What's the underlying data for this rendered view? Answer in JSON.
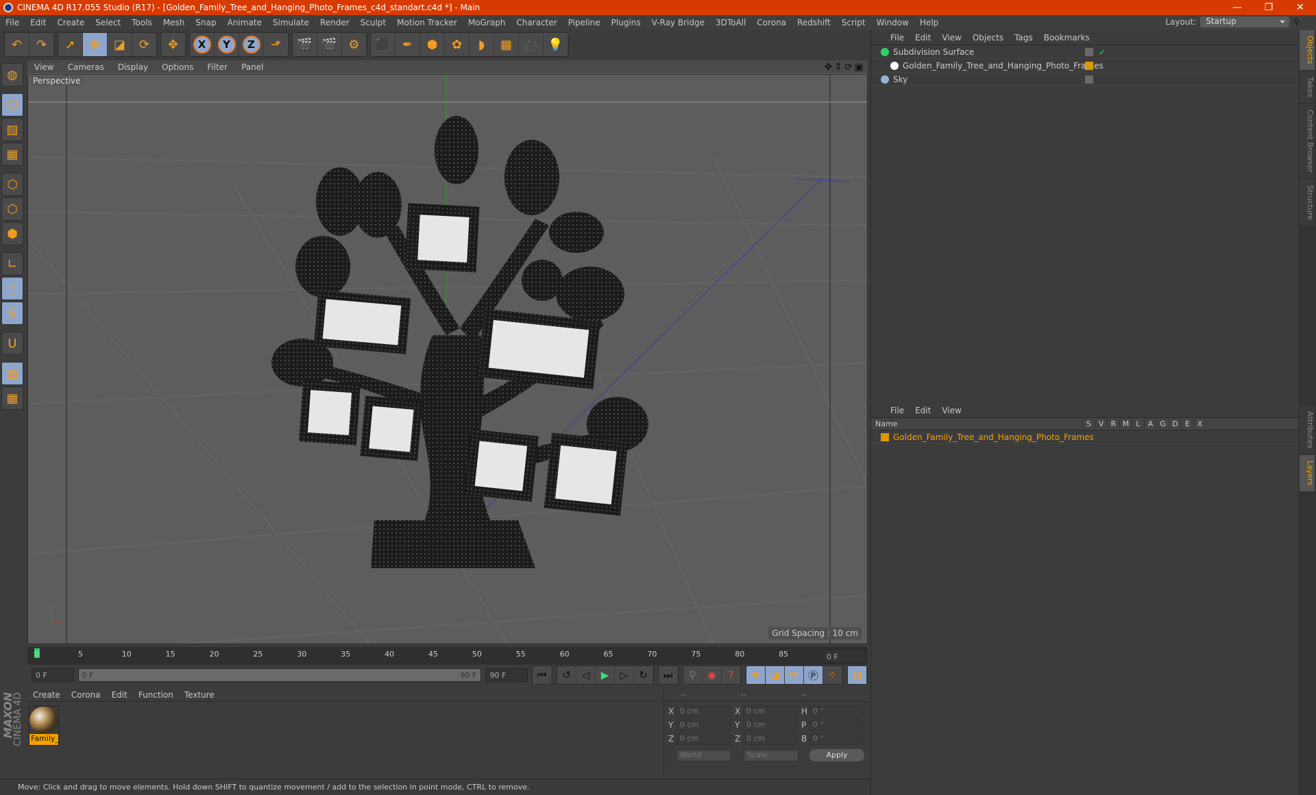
{
  "window": {
    "title": "CINEMA 4D R17.055 Studio (R17) - [Golden_Family_Tree_and_Hanging_Photo_Frames_c4d_standart.c4d *] - Main",
    "controls": [
      "minimize",
      "restore",
      "close"
    ]
  },
  "menubar": [
    "File",
    "Edit",
    "Create",
    "Select",
    "Tools",
    "Mesh",
    "Snap",
    "Animate",
    "Simulate",
    "Render",
    "Sculpt",
    "Motion Tracker",
    "MoGraph",
    "Character",
    "Pipeline",
    "Plugins",
    "V-Ray Bridge",
    "3DToAll",
    "Corona",
    "Redshift",
    "Script",
    "Window",
    "Help"
  ],
  "layout": {
    "label": "Layout:",
    "value": "Startup"
  },
  "toolbar": {
    "groups": [
      [
        {
          "name": "undo-icon",
          "glyph": "↶"
        },
        {
          "name": "redo-icon",
          "glyph": "↷"
        }
      ],
      [
        {
          "name": "select-icon",
          "glyph": "➚",
          "active": false
        },
        {
          "name": "move-icon",
          "glyph": "✥",
          "active": true
        },
        {
          "name": "scale-icon",
          "glyph": "◪"
        },
        {
          "name": "rotate-icon",
          "glyph": "⟳"
        }
      ],
      [
        {
          "name": "live-move-icon",
          "glyph": "✥"
        }
      ],
      [
        {
          "name": "x-axis-icon",
          "glyph": "X",
          "circle": true
        },
        {
          "name": "y-axis-icon",
          "glyph": "Y",
          "circle": true
        },
        {
          "name": "z-axis-icon",
          "glyph": "Z",
          "circle": true
        },
        {
          "name": "coordinate-system-icon",
          "glyph": "⬏"
        }
      ],
      [
        {
          "name": "render-view-icon",
          "glyph": "🎬"
        },
        {
          "name": "render-picture-viewer-icon",
          "glyph": "🎬"
        },
        {
          "name": "render-settings-icon",
          "glyph": "⚙"
        }
      ],
      [
        {
          "name": "cube-icon",
          "glyph": "⬛"
        },
        {
          "name": "pen-icon",
          "glyph": "✒"
        },
        {
          "name": "subdivision-icon",
          "glyph": "⬢"
        },
        {
          "name": "cloner-icon",
          "glyph": "✿"
        },
        {
          "name": "deformer-icon",
          "glyph": "◗"
        },
        {
          "name": "floor-icon",
          "glyph": "▦"
        },
        {
          "name": "camera-icon",
          "glyph": "🎥"
        },
        {
          "name": "light-icon",
          "glyph": "💡"
        }
      ]
    ]
  },
  "lefttools": [
    {
      "name": "model-mode-icon",
      "glyph": "◍",
      "active": false
    },
    {
      "sep": true
    },
    {
      "name": "object-mode-icon",
      "glyph": "⬡",
      "active": true
    },
    {
      "name": "texture-mode-icon",
      "glyph": "▨",
      "active": false
    },
    {
      "name": "workplane-icon",
      "glyph": "▦",
      "active": false
    },
    {
      "sep": true
    },
    {
      "name": "points-mode-icon",
      "glyph": "⬡",
      "active": false
    },
    {
      "name": "edges-mode-icon",
      "glyph": "⬡",
      "active": false
    },
    {
      "name": "polygons-mode-icon",
      "glyph": "⬢",
      "active": false
    },
    {
      "sep": true
    },
    {
      "name": "axis-mode-icon",
      "glyph": "∟",
      "active": false
    },
    {
      "name": "tweak-mode-icon",
      "glyph": "🖱",
      "active": true
    },
    {
      "name": "snap-icon",
      "glyph": "S",
      "active": true
    },
    {
      "sep": true
    },
    {
      "name": "magnet-icon",
      "glyph": "U",
      "active": false
    },
    {
      "sep": true
    },
    {
      "name": "lock-workplane-icon",
      "glyph": "▦",
      "active": true
    },
    {
      "name": "workplane-align-icon",
      "glyph": "▦",
      "active": false
    }
  ],
  "viewport": {
    "menu": [
      "View",
      "Cameras",
      "Display",
      "Options",
      "Filter",
      "Panel"
    ],
    "camera_label": "Perspective",
    "grid_spacing": "Grid Spacing : 10 cm",
    "nav_icons": [
      "move-view-icon",
      "zoom-view-icon",
      "rotate-view-icon",
      "maximize-view-icon"
    ]
  },
  "timeline": {
    "ticks": [
      0,
      5,
      10,
      15,
      20,
      25,
      30,
      35,
      40,
      45,
      50,
      55,
      60,
      65,
      70,
      75,
      80,
      85,
      90
    ],
    "current_frame": "0 F",
    "start_field": "0 F",
    "range_start": "0 F",
    "range_end": "90 F",
    "end_field": "90 F"
  },
  "playback": {
    "buttons": [
      "go-to-start-icon",
      "go-to-previous-key-icon",
      "step-back-icon",
      "play-icon",
      "step-forward-icon",
      "go-to-next-key-icon",
      "go-to-end-icon"
    ],
    "keying": [
      "motion-record-icon",
      "autokey-icon",
      "keyframe-selection-icon"
    ],
    "tracks": [
      "position-track-icon",
      "scale-track-icon",
      "rotation-track-icon",
      "parameter-track-icon",
      "point-level-icon"
    ],
    "timeline_icon": "timeline-icon"
  },
  "material_manager": {
    "menu": [
      "Create",
      "Corona",
      "Edit",
      "Function",
      "Texture"
    ],
    "materials": [
      {
        "label": "Family_T"
      }
    ]
  },
  "coordinates": {
    "headers": [
      "--",
      "--",
      "--"
    ],
    "rows": [
      {
        "a": "X",
        "av": "0 cm",
        "b": "X",
        "bv": "0 cm",
        "c": "H",
        "cv": "0 °"
      },
      {
        "a": "Y",
        "av": "0 cm",
        "b": "Y",
        "bv": "0 cm",
        "c": "P",
        "cv": "0 °"
      },
      {
        "a": "Z",
        "av": "0 cm",
        "b": "Z",
        "bv": "0 cm",
        "c": "B",
        "cv": "0 °"
      }
    ],
    "mode": "World",
    "transform": "Scale",
    "apply": "Apply"
  },
  "brand": {
    "maxon": "MAXON",
    "product": "CINEMA 4D"
  },
  "status": "Move: Click and drag to move elements. Hold down SHIFT to quantize movement / add to the selection in point mode, CTRL to remove.",
  "objects": {
    "menu": [
      "File",
      "Edit",
      "View",
      "Objects",
      "Tags",
      "Bookmarks"
    ],
    "items": [
      {
        "name": "Subdivision Surface",
        "icon": "subdivision-icon",
        "color": "#2ecf6a",
        "indent": 0,
        "check": "✓"
      },
      {
        "name": "Golden_Family_Tree_and_Hanging_Photo_Frames",
        "icon": "null-object-icon",
        "color": "#ffffff",
        "indent": 1,
        "tag": "#d99a0a"
      },
      {
        "name": "Sky",
        "icon": "sky-icon",
        "color": "#9ab4d8",
        "indent": 0
      }
    ]
  },
  "layers": {
    "menu": [
      "File",
      "Edit",
      "View"
    ],
    "columns": [
      "Name",
      "S",
      "V",
      "R",
      "M",
      "L",
      "A",
      "G",
      "D",
      "E",
      "X"
    ],
    "items": [
      {
        "name": "Golden_Family_Tree_and_Hanging_Photo_Frames",
        "color": "#d99a0a"
      }
    ]
  },
  "right_tabs": {
    "top": [
      {
        "label": "Objects",
        "active": true
      },
      {
        "label": "Takes"
      },
      {
        "label": "Content Browser"
      },
      {
        "label": "Structure"
      }
    ],
    "bottom": [
      {
        "label": "Attributes"
      },
      {
        "label": "Layers",
        "active": true
      }
    ]
  },
  "colors": {
    "accent": "#f5a200",
    "titlebar": "#d73b02",
    "active_tool": "#8ea6cc"
  }
}
